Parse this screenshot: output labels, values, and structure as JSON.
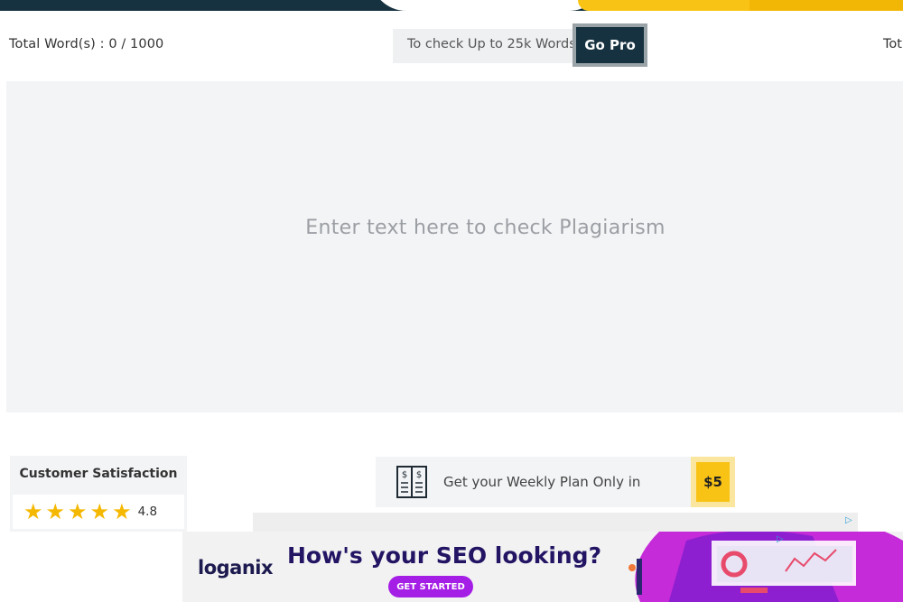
{
  "header": {
    "word_count": "Total Word(s) : 0 / 1000",
    "word_count_right": "Tot",
    "pro_prompt": "To check Up to 25k Words",
    "go_pro_label": "Go Pro"
  },
  "editor": {
    "placeholder": "Enter text here to check Plagiarism",
    "value": ""
  },
  "satisfaction": {
    "title": "Customer Satisfaction",
    "rating": "4.8",
    "stars": 5,
    "star_color": "#f5b800"
  },
  "plan": {
    "icon": "invoice-icon",
    "text": "Get your Weekly Plan Only in",
    "price": "$5",
    "accent": "#f8c315"
  },
  "ad": {
    "logo": "loganix",
    "headline": "How's your SEO looking?",
    "cta": "GET STARTED",
    "adchoices_icon": "ad-choices-icon"
  },
  "colors": {
    "brand_dark": "#16313f",
    "brand_yellow": "#f8c315",
    "panel_bg": "#f3f4f6"
  }
}
